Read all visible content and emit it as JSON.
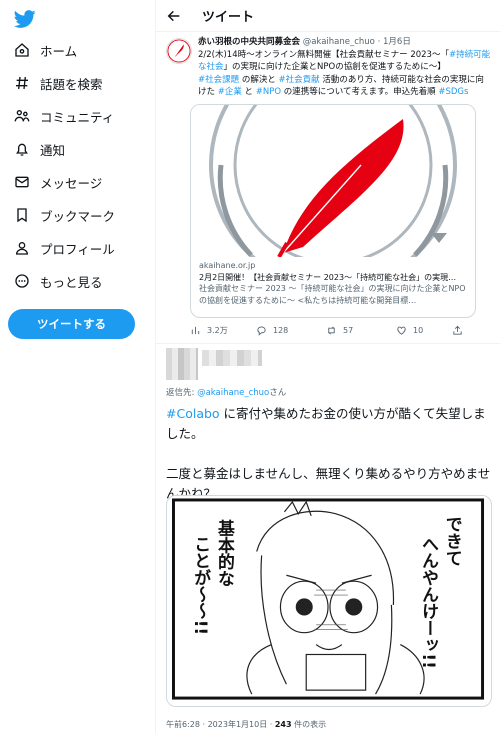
{
  "nav": {
    "items": [
      {
        "label": "ホーム",
        "icon": "home-icon"
      },
      {
        "label": "話題を検索",
        "icon": "hashtag-icon"
      },
      {
        "label": "コミュニティ",
        "icon": "communities-icon"
      },
      {
        "label": "通知",
        "icon": "bell-icon"
      },
      {
        "label": "メッセージ",
        "icon": "mail-icon"
      },
      {
        "label": "ブックマーク",
        "icon": "bookmark-icon"
      },
      {
        "label": "プロフィール",
        "icon": "person-icon"
      },
      {
        "label": "もっと見る",
        "icon": "more-icon"
      }
    ],
    "tweet_button": "ツイートする"
  },
  "header": {
    "title": "ツイート"
  },
  "quoted_tweet": {
    "name": "赤い羽根の中央共同募金会",
    "handle": "@akaihane_chuo",
    "date": "· 1月6日",
    "text_1": "2/2(木)14時〜オンライン無料開催【社会貢献セミナー 2023〜「",
    "link_1": "#持続可能な社会",
    "text_2": "」の実現に向けた企業とNPOの協創を促進するために〜】",
    "link_2": "#社会課題",
    "text_3": " の解決と ",
    "link_3": "#社会貢献",
    "text_4": " 活動のあり方、持続可能な社会の実現に向けた ",
    "link_4": "#企業",
    "text_5": " と ",
    "link_5": "#NPO",
    "text_6": " の連携等について考えます。申込先着順 ",
    "link_6": "#SDGs",
    "card": {
      "domain": "akaihane.or.jp",
      "title": "2月2日開催！【社会貢献セミナー 2023〜「持続可能な社会」の実現…",
      "description": "社会貢献セミナー 2023 〜「持続可能な社会」の実現に向けた企業とNPOの協創を促進するために〜 <私たちは持続可能な開発目標…"
    },
    "stats": {
      "views": "3.2万",
      "replies": "128",
      "retweets": "57",
      "likes": "10"
    }
  },
  "tweet": {
    "reply_prefix": "返信先: ",
    "reply_handle": "@akaihane_chuo",
    "reply_suffix": "さん",
    "hashtag": "#Colabo",
    "text_1": " に寄付や集めたお金の使い方が酷くて失望しました。",
    "text_2": "二度と募金はしませんし、無理くり集めるやり方やめませんかね？",
    "comic": {
      "line_1": "基本的な",
      "line_2": "ことが〜〜!!",
      "line_3": "できて",
      "line_4": "へんやんけーッ!!"
    },
    "time": "午前6:28 · 2023年1月10日 · ",
    "views": "243",
    "views_suffix": " 件の表示"
  },
  "colors": {
    "accent": "#1d9bf0",
    "feather": "#e50012",
    "text": "#0f1419",
    "muted": "#536471"
  }
}
